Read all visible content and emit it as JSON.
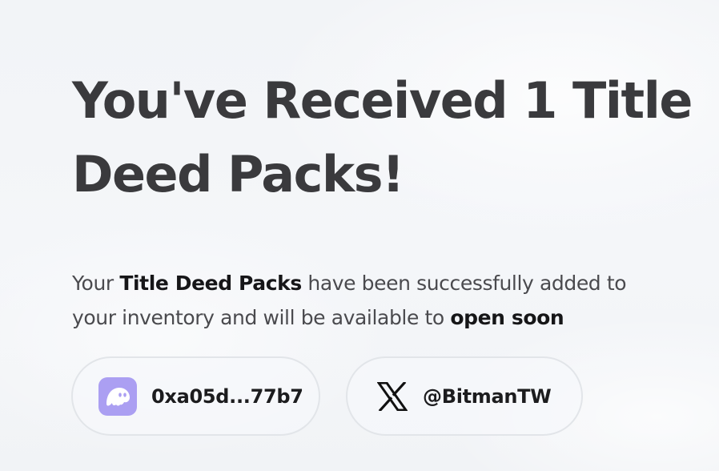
{
  "headline": {
    "line1": "You've Received 1 Title",
    "line2": "Deed Packs!"
  },
  "description": {
    "part1": "Your ",
    "bold1": "Title Deed Packs",
    "part2": " have been successfully added to",
    "part3": "your inventory and will be available to ",
    "bold2": "open soon"
  },
  "wallet": {
    "address": "0xa05d...77b7",
    "icon": "phantom-wallet-icon",
    "icon_color": "#ab9ff2"
  },
  "social": {
    "handle": "@BitmanTW",
    "icon": "x-logo-icon"
  }
}
